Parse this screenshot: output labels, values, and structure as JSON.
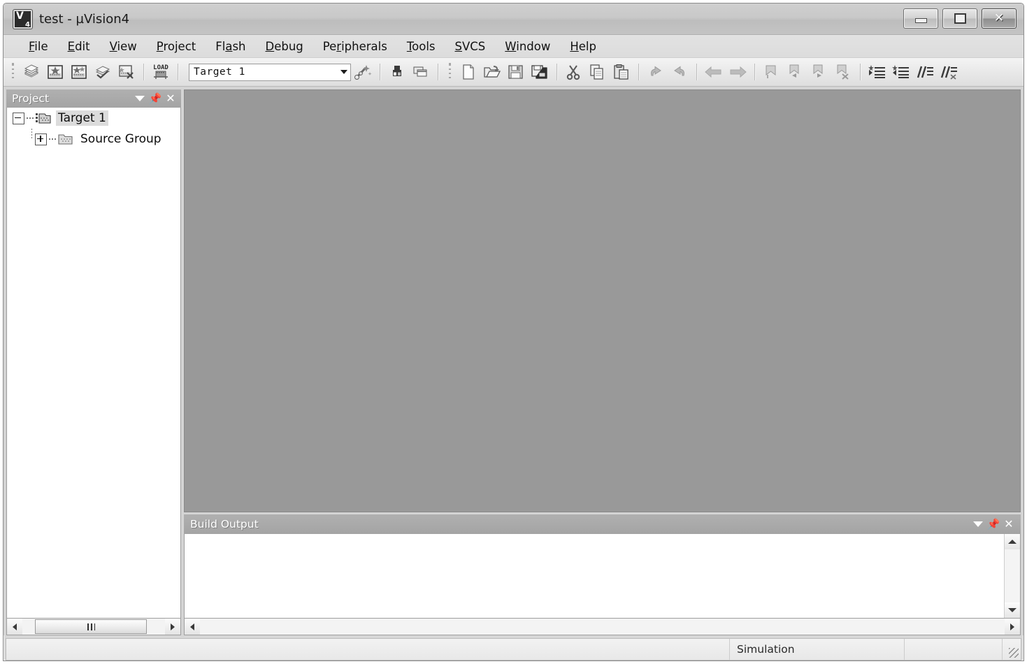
{
  "window": {
    "title": "test  - µVision4",
    "app_icon": "uvision-app-icon",
    "buttons": {
      "minimize": "minimize-button",
      "restore": "restore-button",
      "close": "close-button"
    }
  },
  "menubar": {
    "items": [
      {
        "label": "File",
        "pre": "",
        "accel": "F",
        "post": "ile"
      },
      {
        "label": "Edit",
        "pre": "",
        "accel": "E",
        "post": "dit"
      },
      {
        "label": "View",
        "pre": "",
        "accel": "V",
        "post": "iew"
      },
      {
        "label": "Project",
        "pre": "",
        "accel": "P",
        "post": "roject"
      },
      {
        "label": "Flash",
        "pre": "Fl",
        "accel": "a",
        "post": "sh"
      },
      {
        "label": "Debug",
        "pre": "",
        "accel": "D",
        "post": "ebug"
      },
      {
        "label": "Peripherals",
        "pre": "Pe",
        "accel": "r",
        "post": "ipherals"
      },
      {
        "label": "Tools",
        "pre": "",
        "accel": "T",
        "post": "ools"
      },
      {
        "label": "SVCS",
        "pre": "",
        "accel": "S",
        "post": "VCS"
      },
      {
        "label": "Window",
        "pre": "",
        "accel": "W",
        "post": "indow"
      },
      {
        "label": "Help",
        "pre": "",
        "accel": "H",
        "post": "elp"
      }
    ]
  },
  "toolbar": {
    "build_buttons": [
      {
        "name": "translate-button",
        "tooltip": "Translate"
      },
      {
        "name": "build-button",
        "tooltip": "Build"
      },
      {
        "name": "rebuild-button",
        "tooltip": "Rebuild"
      },
      {
        "name": "batch-build-button",
        "tooltip": "Batch Build"
      },
      {
        "name": "stop-build-button",
        "tooltip": "Stop Build"
      },
      {
        "name": "download-button",
        "tooltip": "Download",
        "label": "LOAD"
      }
    ],
    "target_combo": {
      "value": "Target 1",
      "name": "target-select"
    },
    "project_buttons": [
      {
        "name": "target-options-button",
        "tooltip": "Options for Target"
      },
      {
        "name": "manage-components-button",
        "tooltip": "Manage Components"
      },
      {
        "name": "project-windows-button",
        "tooltip": "Project Windows"
      }
    ],
    "file_buttons": [
      {
        "name": "new-file-button",
        "tooltip": "New"
      },
      {
        "name": "open-file-button",
        "tooltip": "Open"
      },
      {
        "name": "save-button",
        "tooltip": "Save"
      },
      {
        "name": "save-all-button",
        "tooltip": "Save All"
      }
    ],
    "edit_buttons": [
      {
        "name": "cut-button",
        "tooltip": "Cut"
      },
      {
        "name": "copy-button",
        "tooltip": "Copy"
      },
      {
        "name": "paste-button",
        "tooltip": "Paste"
      }
    ],
    "undo_buttons": [
      {
        "name": "undo-button",
        "tooltip": "Undo"
      },
      {
        "name": "redo-button",
        "tooltip": "Redo"
      }
    ],
    "nav_buttons": [
      {
        "name": "navigate-backward-button",
        "tooltip": "Back"
      },
      {
        "name": "navigate-forward-button",
        "tooltip": "Forward"
      }
    ],
    "bookmark_buttons": [
      {
        "name": "toggle-bookmark-button",
        "tooltip": "Insert/Remove Bookmark"
      },
      {
        "name": "previous-bookmark-button",
        "tooltip": "Go to Previous Bookmark"
      },
      {
        "name": "next-bookmark-button",
        "tooltip": "Go to Next Bookmark"
      },
      {
        "name": "clear-bookmarks-button",
        "tooltip": "Clear All Bookmarks"
      }
    ],
    "indent_buttons": [
      {
        "name": "indent-button",
        "tooltip": "Indent Selected Text"
      },
      {
        "name": "outdent-button",
        "tooltip": "Outdent Selected Text"
      },
      {
        "name": "comment-button",
        "tooltip": "Comment Selection"
      },
      {
        "name": "uncomment-button",
        "tooltip": "Uncomment Selection"
      }
    ]
  },
  "project_panel": {
    "title": "Project",
    "caption_buttons": {
      "dropdown": "panel-menu-button",
      "pin": "panel-pin-button",
      "close": "panel-close-button"
    },
    "tree": [
      {
        "label": "Target 1",
        "expanded": true,
        "selected": true,
        "icon": "target-icon",
        "level": 0
      },
      {
        "label": "Source Group",
        "expanded": false,
        "selected": false,
        "icon": "folder-icon",
        "level": 1
      }
    ]
  },
  "build_output": {
    "title": "Build Output",
    "content": "",
    "caption_buttons": {
      "dropdown": "panel-menu-button",
      "pin": "panel-pin-button",
      "close": "panel-close-button"
    }
  },
  "statusbar": {
    "left": "",
    "simulation": "Simulation",
    "extra": ""
  },
  "colors": {
    "mdi_background": "#999999",
    "titlebar": "#c8c8c8",
    "panel_caption": "#a8a8a8",
    "panel_caption_text": "#ffffff",
    "tree_selection": "#dcdcdc",
    "window_background": "#d4d4d4"
  }
}
